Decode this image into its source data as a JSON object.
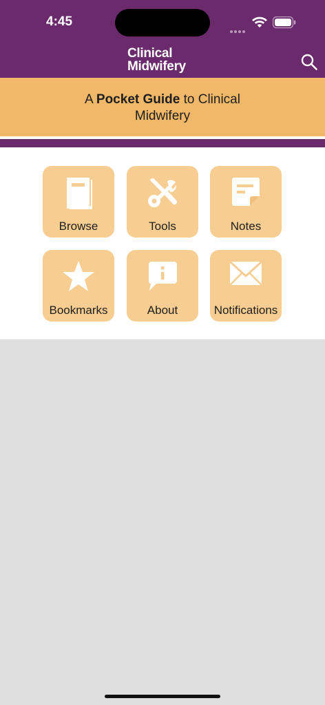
{
  "status": {
    "time": "4:45"
  },
  "header": {
    "logo_line1": "Clinical",
    "logo_line2": "Midwifery"
  },
  "banner": {
    "prefix": "A ",
    "bold": "Pocket Guide",
    "suffix": " to Clinical",
    "line2": "Midwifery"
  },
  "tiles": [
    {
      "label": "Browse",
      "icon": "book-icon"
    },
    {
      "label": "Tools",
      "icon": "tools-icon"
    },
    {
      "label": "Notes",
      "icon": "note-icon"
    },
    {
      "label": "Bookmarks",
      "icon": "star-icon"
    },
    {
      "label": "About",
      "icon": "info-bubble-icon"
    },
    {
      "label": "Notifications",
      "icon": "envelope-icon"
    }
  ],
  "colors": {
    "brand_purple": "#6b2a6c",
    "banner_orange": "#f2b86a",
    "tile_peach": "#f7cd92"
  }
}
